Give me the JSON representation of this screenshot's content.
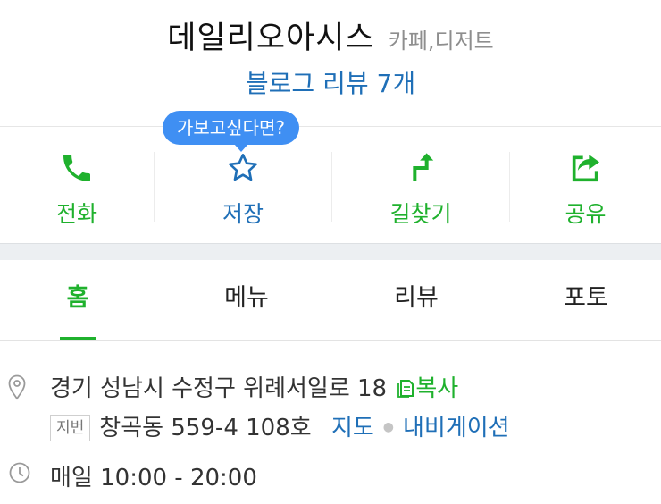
{
  "place": {
    "name": "데일리오아시스",
    "category": "카페,디저트",
    "review_link": "블로그 리뷰 7개"
  },
  "tooltip": "가보고싶다면?",
  "actions": [
    {
      "label": "전화",
      "icon": "phone-icon"
    },
    {
      "label": "저장",
      "icon": "star-icon"
    },
    {
      "label": "길찾기",
      "icon": "directions-icon"
    },
    {
      "label": "공유",
      "icon": "share-icon"
    }
  ],
  "tabs": [
    {
      "label": "홈",
      "active": true
    },
    {
      "label": "메뉴",
      "active": false
    },
    {
      "label": "리뷰",
      "active": false
    },
    {
      "label": "포토",
      "active": false
    }
  ],
  "info": {
    "address": "경기 성남시 수정구 위례서일로 18",
    "copy_label": "복사",
    "jibun_badge": "지번",
    "jibun_address": "창곡동 559-4 108호",
    "map_link": "지도",
    "navigation_link": "내비게이션",
    "hours": "매일 10:00 - 20:00"
  },
  "colors": {
    "green": "#1fb12d",
    "blue": "#1f6fb7",
    "tooltip": "#3f8ff3"
  }
}
